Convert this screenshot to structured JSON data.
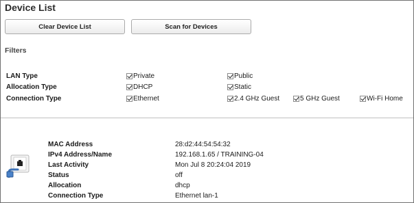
{
  "header": {
    "title": "Device List"
  },
  "toolbar": {
    "clear_label": "Clear Device List",
    "scan_label": "Scan for Devices"
  },
  "filters": {
    "heading": "Filters",
    "lan_type": {
      "label": "LAN Type",
      "options": [
        {
          "label": "Private",
          "checked": true
        },
        {
          "label": "Public",
          "checked": true
        }
      ]
    },
    "allocation_type": {
      "label": "Allocation Type",
      "options": [
        {
          "label": "DHCP",
          "checked": true
        },
        {
          "label": "Static",
          "checked": true
        }
      ]
    },
    "connection_type": {
      "label": "Connection Type",
      "options": [
        {
          "label": "Ethernet",
          "checked": true
        },
        {
          "label": "2.4 GHz Guest",
          "checked": true
        },
        {
          "label": "5 GHz Guest",
          "checked": true
        },
        {
          "label": "Wi-Fi Home",
          "checked": true
        }
      ]
    }
  },
  "device": {
    "icon": "network-device-icon",
    "fields": [
      {
        "label": "MAC Address",
        "value": "28:d2:44:54:54:32"
      },
      {
        "label": "IPv4 Address/Name",
        "value": "192.168.1.65 / TRAINING-04"
      },
      {
        "label": "Last Activity",
        "value": "Mon Jul 8 20:24:04 2019"
      },
      {
        "label": "Status",
        "value": "off"
      },
      {
        "label": "Allocation",
        "value": "dhcp"
      },
      {
        "label": "Connection Type",
        "value": "Ethernet lan-1"
      }
    ]
  },
  "colors": {
    "border": "#6f6f6f",
    "icon_blue": "#3f74b8",
    "text": "#1a1a1a"
  }
}
